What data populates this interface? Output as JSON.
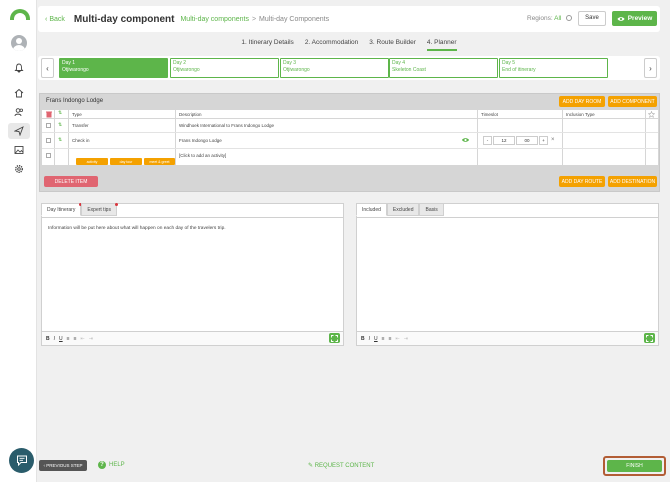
{
  "header": {
    "back_label": "Back",
    "title": "Multi-day component",
    "breadcrumb_link": "Multi-day components",
    "breadcrumb_sep": ">",
    "breadcrumb_current": "Multi-day Components",
    "regions_label": "Regions:",
    "regions_value": "All",
    "save_label": "Save",
    "preview_label": "Preview"
  },
  "steps": [
    {
      "label": "1. Itinerary Details"
    },
    {
      "label": "2. Accommodation"
    },
    {
      "label": "3. Route Builder"
    },
    {
      "label": "4. Planner",
      "active": true
    }
  ],
  "days": [
    {
      "day": "Day 1",
      "place": "Otjiwarongo",
      "active": true
    },
    {
      "day": "Day 2",
      "place": "Otjiwarongo"
    },
    {
      "day": "Day 3",
      "place": "Otjiwarongo"
    },
    {
      "day": "Day 4",
      "place": "Skeleton Coast"
    },
    {
      "day": "Day 5",
      "place": "End of itinerary"
    }
  ],
  "planner": {
    "lodge_name": "Frans Indongo Lodge",
    "add_day_room": "ADD DAY ROOM",
    "add_component": "ADD COMPONENT",
    "columns": {
      "type": "Type",
      "description": "Description",
      "timeslot": "Timeslot",
      "inclusion": "Inclusion Type"
    },
    "rows": [
      {
        "type": "Transfer",
        "description": "Windhoek International to Frans Indongo Lodge"
      },
      {
        "type": "Check in",
        "description": "Frans Indongo Lodge",
        "time_h": "12",
        "time_m": "00"
      }
    ],
    "add_activity_text": "[Click to add an activity]",
    "time_minus": "-",
    "time_plus": "+",
    "time_remove": "×",
    "mini_buttons": [
      "activity",
      "day tour",
      "meet & greet"
    ],
    "delete_item": "DELETE ITEM",
    "add_day_route": "ADD DAY ROUTE",
    "add_destination": "ADD DESTINATION"
  },
  "left_editor": {
    "tabs": [
      "Day Itinerary",
      "Expert tips"
    ],
    "body": "Information will be put here about what will happen on each day of the travelers trip."
  },
  "right_editor": {
    "tabs": [
      "Included",
      "Excluded",
      "Basis"
    ]
  },
  "toolbar": {
    "bold": "B",
    "italic": "I",
    "underline": "U"
  },
  "footer": {
    "previous_step": "PREVIOUS STEP",
    "help": "HELP",
    "help_glyph": "?",
    "request_content": "REQUEST CONTENT",
    "finish": "FINISH"
  },
  "colors": {
    "brand_green": "#5db54a",
    "orange": "#f4a100",
    "delete_red": "#e06571",
    "finish_highlight": "#b25d35"
  }
}
